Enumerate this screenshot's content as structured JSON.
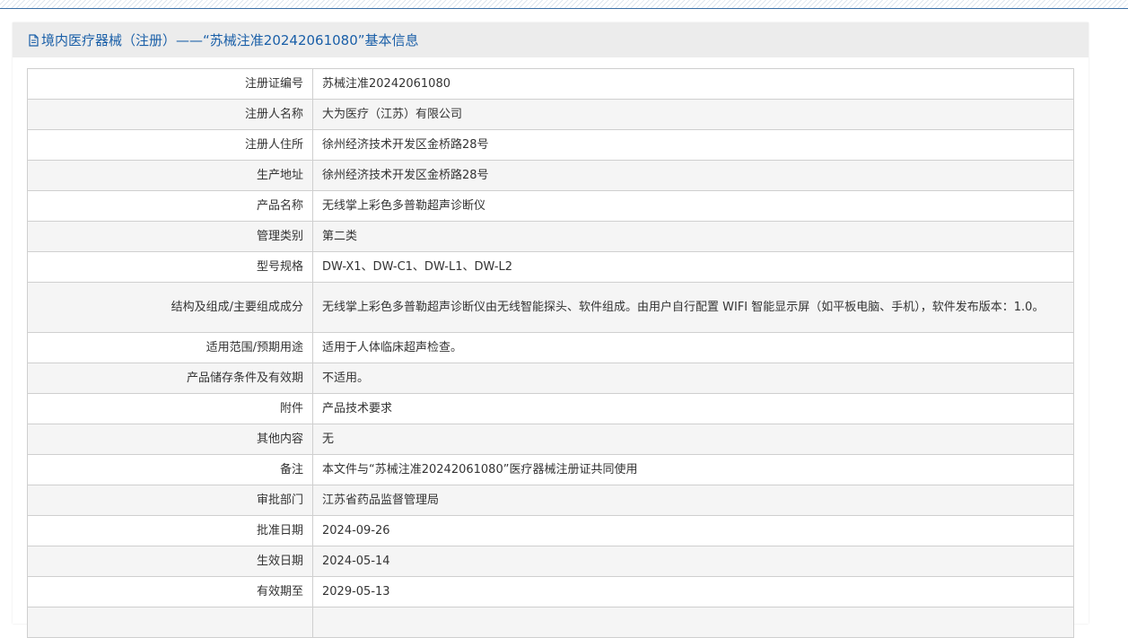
{
  "header": {
    "icon": "document-icon",
    "title": "境内医疗器械（注册）——“苏械注准20242061080”基本信息",
    "accent_color": "#1a5fa8"
  },
  "rows": [
    {
      "label": "注册证编号",
      "value": "苏械注准20242061080"
    },
    {
      "label": "注册人名称",
      "value": "大为医疗（江苏）有限公司"
    },
    {
      "label": "注册人住所",
      "value": "徐州经济技术开发区金桥路28号"
    },
    {
      "label": "生产地址",
      "value": "徐州经济技术开发区金桥路28号"
    },
    {
      "label": "产品名称",
      "value": "无线掌上彩色多普勒超声诊断仪"
    },
    {
      "label": "管理类别",
      "value": "第二类"
    },
    {
      "label": "型号规格",
      "value": "DW-X1、DW-C1、DW-L1、DW-L2"
    },
    {
      "label": "结构及组成/主要组成成分",
      "value": "无线掌上彩色多普勒超声诊断仪由无线智能探头、软件组成。由用户自行配置 WIFI 智能显示屏（如平板电脑、手机），软件发布版本：1.0。"
    },
    {
      "label": "适用范围/预期用途",
      "value": "适用于人体临床超声检查。"
    },
    {
      "label": "产品储存条件及有效期",
      "value": "不适用。"
    },
    {
      "label": "附件",
      "value": "产品技术要求"
    },
    {
      "label": "其他内容",
      "value": "无"
    },
    {
      "label": "备注",
      "value": "本文件与“苏械注准20242061080”医疗器械注册证共同使用"
    },
    {
      "label": "审批部门",
      "value": "江苏省药品监督管理局"
    },
    {
      "label": "批准日期",
      "value": "2024-09-26"
    },
    {
      "label": "生效日期",
      "value": "2024-05-14"
    },
    {
      "label": "有效期至",
      "value": "2029-05-13"
    }
  ]
}
